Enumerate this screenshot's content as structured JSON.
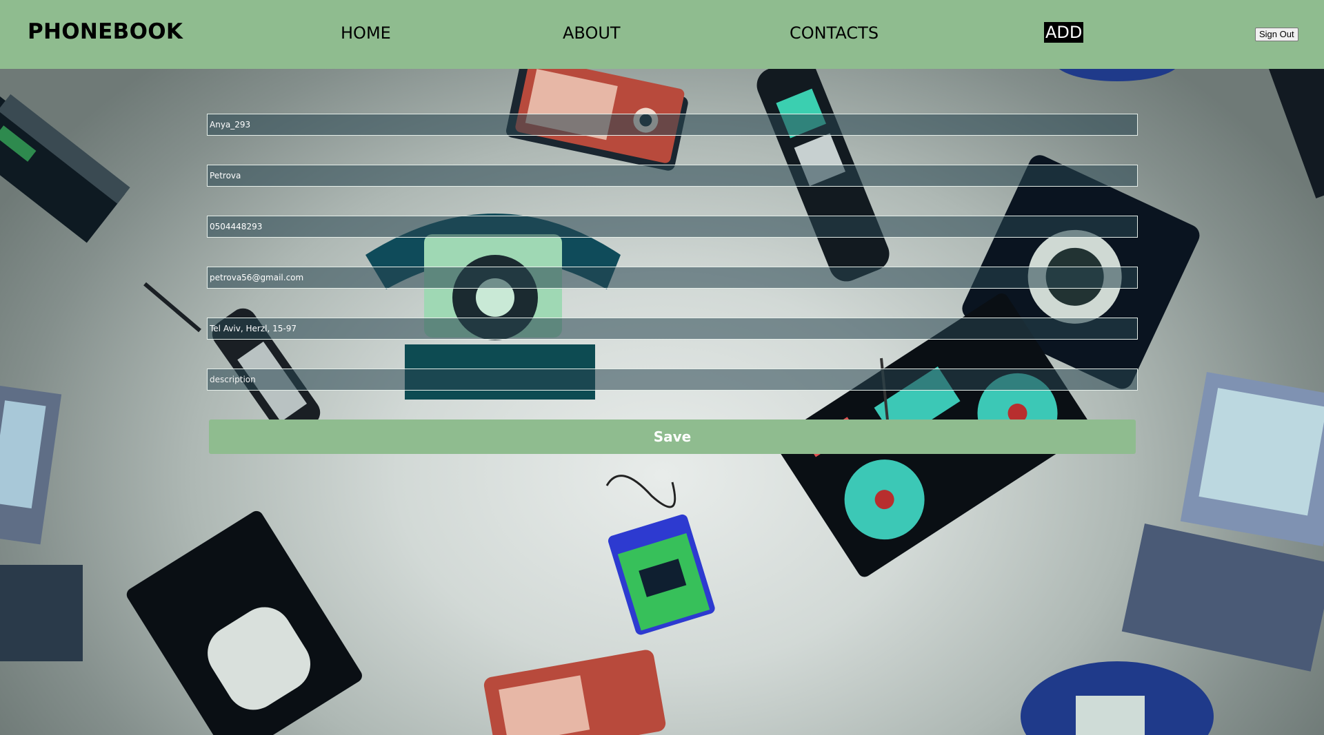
{
  "app": {
    "brand": "PHONEBOOK"
  },
  "nav": {
    "home": "HOME",
    "about": "ABOUT",
    "contacts": "CONTACTS",
    "add": "ADD",
    "active": "add"
  },
  "header": {
    "sign_out_label": "Sign Out"
  },
  "form": {
    "name": {
      "value": "Anya_293",
      "placeholder": ""
    },
    "lastname": {
      "value": "Petrova",
      "placeholder": ""
    },
    "phone": {
      "value": "0504448293",
      "placeholder": ""
    },
    "email": {
      "value": "petrova56@gmail.com",
      "placeholder": ""
    },
    "address": {
      "value": "Tel Aviv, Herzl, 15-97",
      "placeholder": ""
    },
    "description": {
      "value": "",
      "placeholder": "description"
    },
    "save_label": "Save"
  },
  "colors": {
    "header_bg": "#8fbc8f",
    "save_button_bg": "#8fbc8f",
    "active_nav_bg": "#000000",
    "active_nav_text": "#ffffff",
    "field_bg": "rgba(40,70,80,0.55)"
  },
  "background": {
    "illustration": "retro devices: rotary phone, mobile phones, boombox, cassette player, VHS tapes, radios, cameras, computers"
  }
}
